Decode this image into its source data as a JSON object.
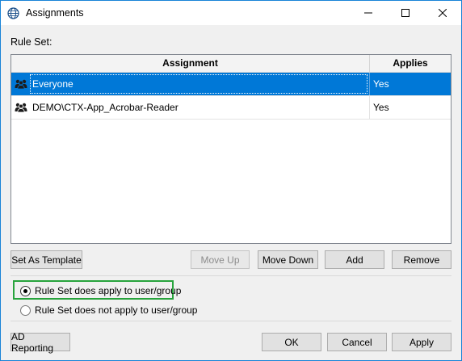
{
  "window": {
    "title": "Assignments",
    "icon": "globe-grid-icon"
  },
  "rule_set_label": "Rule Set:",
  "table": {
    "columns": [
      "Assignment",
      "Applies"
    ],
    "rows": [
      {
        "assignment": "Everyone",
        "applies": "Yes",
        "selected": true
      },
      {
        "assignment": "DEMO\\CTX-App_Acrobar-Reader",
        "applies": "Yes",
        "selected": false
      }
    ]
  },
  "buttons": {
    "set_as_template": "Set As Template",
    "move_up": "Move Up",
    "move_down": "Move Down",
    "add": "Add",
    "remove": "Remove",
    "ad_reporting": "AD Reporting",
    "ok": "OK",
    "cancel": "Cancel",
    "apply": "Apply"
  },
  "radios": {
    "applies": "Rule Set does apply to user/group",
    "not_applies": "Rule Set does not apply to user/group",
    "selected": "applies"
  },
  "colors": {
    "selection": "#0078d7",
    "highlight_border": "#27a33c",
    "window_border": "#1883d7"
  }
}
